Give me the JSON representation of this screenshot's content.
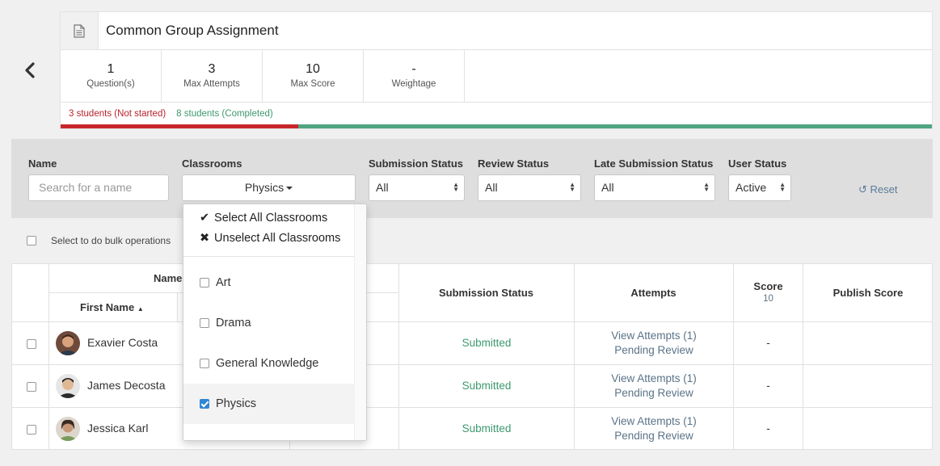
{
  "header": {
    "title": "Common Group Assignment",
    "stats": [
      {
        "value": "1",
        "label": "Question(s)"
      },
      {
        "value": "3",
        "label": "Max Attempts"
      },
      {
        "value": "10",
        "label": "Max Score"
      },
      {
        "value": "-",
        "label": "Weightage"
      }
    ],
    "progress": {
      "not_started_label": "3 students (Not started)",
      "completed_label": "8 students (Completed)",
      "not_started_fraction": 0.273,
      "not_started_color": "#c9252c",
      "completed_color": "#4fa581"
    }
  },
  "filters": {
    "name_label": "Name",
    "name_placeholder": "Search for a name",
    "classrooms_label": "Classrooms",
    "classrooms_value": "Physics",
    "submission_status_label": "Submission Status",
    "submission_status_value": "All",
    "review_status_label": "Review Status",
    "review_status_value": "All",
    "late_submission_label": "Late Submission Status",
    "late_submission_value": "All",
    "user_status_label": "User Status",
    "user_status_value": "Active",
    "reset_label": "Reset"
  },
  "bulk": {
    "label": "Select to do bulk operations"
  },
  "table": {
    "headers": {
      "name": "Name",
      "first_name": "First Name",
      "submission_status": "Submission Status",
      "attempts": "Attempts",
      "score": "Score",
      "score_max": "10",
      "publish_score": "Publish Score"
    },
    "rows": [
      {
        "name": "Exavier Costa",
        "status": "Submitted",
        "attempts": "View Attempts (1)",
        "review": "Pending Review",
        "score": "-"
      },
      {
        "name": "James Decosta",
        "status": "Submitted",
        "attempts": "View Attempts (1)",
        "review": "Pending Review",
        "score": "-"
      },
      {
        "name": "Jessica Karl",
        "status": "Submitted",
        "attempts": "View Attempts (1)",
        "review": "Pending Review",
        "score": "-"
      }
    ]
  },
  "dropdown": {
    "select_all": "Select All Classrooms",
    "unselect_all": "Unselect All Classrooms",
    "items": [
      {
        "label": "Art",
        "checked": false
      },
      {
        "label": "Drama",
        "checked": false
      },
      {
        "label": "General Knowledge",
        "checked": false
      },
      {
        "label": "Physics",
        "checked": true
      }
    ]
  }
}
